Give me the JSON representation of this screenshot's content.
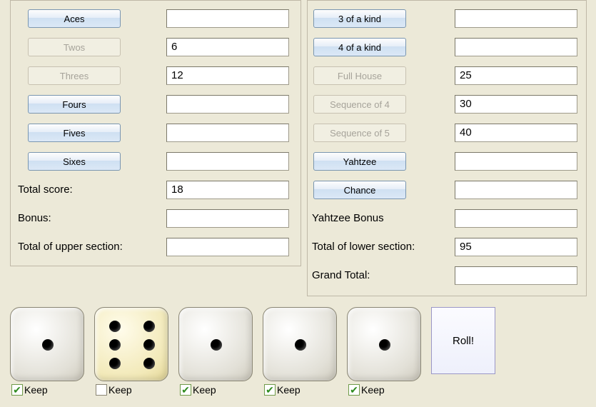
{
  "upper": {
    "categories": [
      {
        "label": "Aces",
        "enabled": true,
        "score": ""
      },
      {
        "label": "Twos",
        "enabled": false,
        "score": "6"
      },
      {
        "label": "Threes",
        "enabled": false,
        "score": "12"
      },
      {
        "label": "Fours",
        "enabled": true,
        "score": ""
      },
      {
        "label": "Fives",
        "enabled": true,
        "score": ""
      },
      {
        "label": "Sixes",
        "enabled": true,
        "score": ""
      }
    ],
    "totals": [
      {
        "label": "Total score:",
        "value": "18"
      },
      {
        "label": "Bonus:",
        "value": ""
      },
      {
        "label": "Total of upper section:",
        "value": ""
      }
    ]
  },
  "lower": {
    "categories": [
      {
        "label": "3 of a kind",
        "enabled": true,
        "score": ""
      },
      {
        "label": "4 of a kind",
        "enabled": true,
        "score": ""
      },
      {
        "label": "Full House",
        "enabled": false,
        "score": "25"
      },
      {
        "label": "Sequence of 4",
        "enabled": false,
        "score": "30"
      },
      {
        "label": "Sequence of 5",
        "enabled": false,
        "score": "40"
      },
      {
        "label": "Yahtzee",
        "enabled": true,
        "score": ""
      },
      {
        "label": "Chance",
        "enabled": true,
        "score": ""
      }
    ],
    "totals": [
      {
        "label": "Yahtzee Bonus",
        "value": ""
      },
      {
        "label": "Total of lower section:",
        "value": "95"
      },
      {
        "label": "Grand Total:",
        "value": ""
      }
    ]
  },
  "dice": [
    {
      "value": 1,
      "kept": true,
      "alt": false
    },
    {
      "value": 6,
      "kept": false,
      "alt": true
    },
    {
      "value": 1,
      "kept": true,
      "alt": false
    },
    {
      "value": 1,
      "kept": true,
      "alt": false
    },
    {
      "value": 1,
      "kept": true,
      "alt": false
    }
  ],
  "keep_label": "Keep",
  "roll_label": "Roll!"
}
